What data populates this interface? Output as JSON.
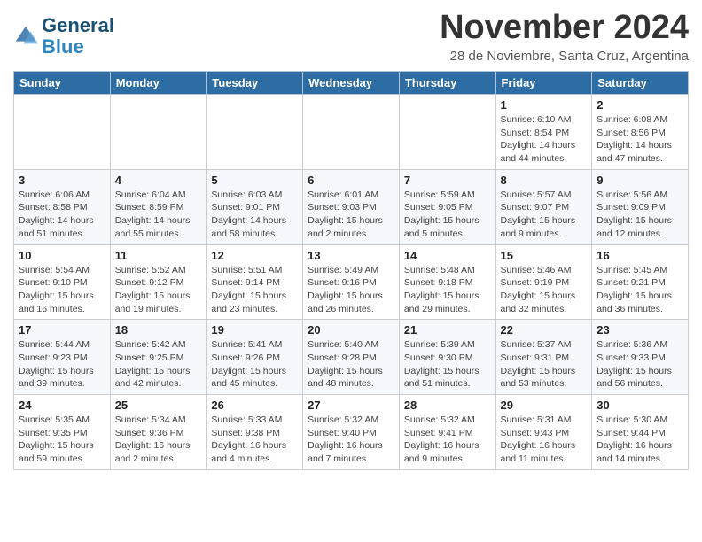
{
  "logo": {
    "line1": "General",
    "line2": "Blue"
  },
  "title": "November 2024",
  "subtitle": "28 de Noviembre, Santa Cruz, Argentina",
  "weekdays": [
    "Sunday",
    "Monday",
    "Tuesday",
    "Wednesday",
    "Thursday",
    "Friday",
    "Saturday"
  ],
  "weeks": [
    [
      {
        "day": "",
        "info": ""
      },
      {
        "day": "",
        "info": ""
      },
      {
        "day": "",
        "info": ""
      },
      {
        "day": "",
        "info": ""
      },
      {
        "day": "",
        "info": ""
      },
      {
        "day": "1",
        "info": "Sunrise: 6:10 AM\nSunset: 8:54 PM\nDaylight: 14 hours\nand 44 minutes."
      },
      {
        "day": "2",
        "info": "Sunrise: 6:08 AM\nSunset: 8:56 PM\nDaylight: 14 hours\nand 47 minutes."
      }
    ],
    [
      {
        "day": "3",
        "info": "Sunrise: 6:06 AM\nSunset: 8:58 PM\nDaylight: 14 hours\nand 51 minutes."
      },
      {
        "day": "4",
        "info": "Sunrise: 6:04 AM\nSunset: 8:59 PM\nDaylight: 14 hours\nand 55 minutes."
      },
      {
        "day": "5",
        "info": "Sunrise: 6:03 AM\nSunset: 9:01 PM\nDaylight: 14 hours\nand 58 minutes."
      },
      {
        "day": "6",
        "info": "Sunrise: 6:01 AM\nSunset: 9:03 PM\nDaylight: 15 hours\nand 2 minutes."
      },
      {
        "day": "7",
        "info": "Sunrise: 5:59 AM\nSunset: 9:05 PM\nDaylight: 15 hours\nand 5 minutes."
      },
      {
        "day": "8",
        "info": "Sunrise: 5:57 AM\nSunset: 9:07 PM\nDaylight: 15 hours\nand 9 minutes."
      },
      {
        "day": "9",
        "info": "Sunrise: 5:56 AM\nSunset: 9:09 PM\nDaylight: 15 hours\nand 12 minutes."
      }
    ],
    [
      {
        "day": "10",
        "info": "Sunrise: 5:54 AM\nSunset: 9:10 PM\nDaylight: 15 hours\nand 16 minutes."
      },
      {
        "day": "11",
        "info": "Sunrise: 5:52 AM\nSunset: 9:12 PM\nDaylight: 15 hours\nand 19 minutes."
      },
      {
        "day": "12",
        "info": "Sunrise: 5:51 AM\nSunset: 9:14 PM\nDaylight: 15 hours\nand 23 minutes."
      },
      {
        "day": "13",
        "info": "Sunrise: 5:49 AM\nSunset: 9:16 PM\nDaylight: 15 hours\nand 26 minutes."
      },
      {
        "day": "14",
        "info": "Sunrise: 5:48 AM\nSunset: 9:18 PM\nDaylight: 15 hours\nand 29 minutes."
      },
      {
        "day": "15",
        "info": "Sunrise: 5:46 AM\nSunset: 9:19 PM\nDaylight: 15 hours\nand 32 minutes."
      },
      {
        "day": "16",
        "info": "Sunrise: 5:45 AM\nSunset: 9:21 PM\nDaylight: 15 hours\nand 36 minutes."
      }
    ],
    [
      {
        "day": "17",
        "info": "Sunrise: 5:44 AM\nSunset: 9:23 PM\nDaylight: 15 hours\nand 39 minutes."
      },
      {
        "day": "18",
        "info": "Sunrise: 5:42 AM\nSunset: 9:25 PM\nDaylight: 15 hours\nand 42 minutes."
      },
      {
        "day": "19",
        "info": "Sunrise: 5:41 AM\nSunset: 9:26 PM\nDaylight: 15 hours\nand 45 minutes."
      },
      {
        "day": "20",
        "info": "Sunrise: 5:40 AM\nSunset: 9:28 PM\nDaylight: 15 hours\nand 48 minutes."
      },
      {
        "day": "21",
        "info": "Sunrise: 5:39 AM\nSunset: 9:30 PM\nDaylight: 15 hours\nand 51 minutes."
      },
      {
        "day": "22",
        "info": "Sunrise: 5:37 AM\nSunset: 9:31 PM\nDaylight: 15 hours\nand 53 minutes."
      },
      {
        "day": "23",
        "info": "Sunrise: 5:36 AM\nSunset: 9:33 PM\nDaylight: 15 hours\nand 56 minutes."
      }
    ],
    [
      {
        "day": "24",
        "info": "Sunrise: 5:35 AM\nSunset: 9:35 PM\nDaylight: 15 hours\nand 59 minutes."
      },
      {
        "day": "25",
        "info": "Sunrise: 5:34 AM\nSunset: 9:36 PM\nDaylight: 16 hours\nand 2 minutes."
      },
      {
        "day": "26",
        "info": "Sunrise: 5:33 AM\nSunset: 9:38 PM\nDaylight: 16 hours\nand 4 minutes."
      },
      {
        "day": "27",
        "info": "Sunrise: 5:32 AM\nSunset: 9:40 PM\nDaylight: 16 hours\nand 7 minutes."
      },
      {
        "day": "28",
        "info": "Sunrise: 5:32 AM\nSunset: 9:41 PM\nDaylight: 16 hours\nand 9 minutes."
      },
      {
        "day": "29",
        "info": "Sunrise: 5:31 AM\nSunset: 9:43 PM\nDaylight: 16 hours\nand 11 minutes."
      },
      {
        "day": "30",
        "info": "Sunrise: 5:30 AM\nSunset: 9:44 PM\nDaylight: 16 hours\nand 14 minutes."
      }
    ]
  ]
}
